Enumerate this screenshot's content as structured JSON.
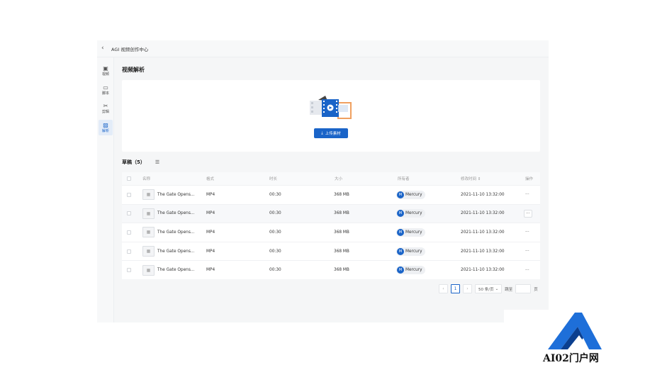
{
  "header": {
    "title": "AGI 视频创作中心"
  },
  "sidebar": {
    "items": [
      {
        "label": "视频",
        "icon": "play-square-icon"
      },
      {
        "label": "脚本",
        "icon": "script-icon"
      },
      {
        "label": "剪辑",
        "icon": "scissors-icon"
      },
      {
        "label": "解析",
        "icon": "image-analyze-icon",
        "active": true
      }
    ]
  },
  "main": {
    "title": "视频解析",
    "upload_label": "上传素材",
    "drafts_label": "草稿（5）"
  },
  "table": {
    "headers": [
      "名称",
      "格式",
      "时长",
      "大小",
      "所有者",
      "修改时间 ⇕",
      "操作"
    ],
    "rows": [
      {
        "name": "The Gate Opens...",
        "format": "MP4",
        "duration": "00:30",
        "size": "368 MB",
        "owner": "Mercury",
        "owner_initial": "M",
        "modified": "2021-11-10 13:32:00",
        "action": "···"
      },
      {
        "name": "The Gate Opens...",
        "format": "MP4",
        "duration": "00:30",
        "size": "368 MB",
        "owner": "Mercury",
        "owner_initial": "M",
        "modified": "2021-11-10 13:32:00",
        "action": "···"
      },
      {
        "name": "The Gate Opens...",
        "format": "MP4",
        "duration": "00:30",
        "size": "368 MB",
        "owner": "Mercury",
        "owner_initial": "M",
        "modified": "2021-11-10 13:32:00",
        "action": "···"
      },
      {
        "name": "The Gate Opens...",
        "format": "MP4",
        "duration": "00:30",
        "size": "368 MB",
        "owner": "Mercury",
        "owner_initial": "M",
        "modified": "2021-11-10 13:32:00",
        "action": "···"
      },
      {
        "name": "The Gate Opens...",
        "format": "MP4",
        "duration": "00:30",
        "size": "368 MB",
        "owner": "Mercury",
        "owner_initial": "M",
        "modified": "2021-11-10 13:32:00",
        "action": "···"
      }
    ]
  },
  "pagination": {
    "prev": "‹",
    "page": "1",
    "next": "›",
    "page_size": "50 条/页",
    "jump_label": "跳至",
    "page_unit": "页"
  },
  "watermark": {
    "text": "AI02门户网"
  },
  "colors": {
    "accent": "#1a64c8",
    "logo_blue": "#1e6fd9"
  }
}
